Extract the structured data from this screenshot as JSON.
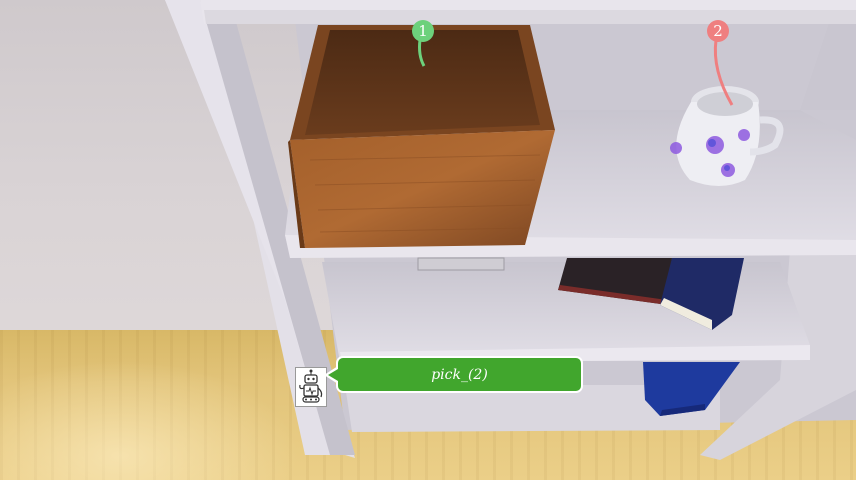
{
  "colors": {
    "marker_1": "#6dd17c",
    "marker_2": "#ef7f80",
    "bubble": "#41a62d"
  },
  "markers": [
    {
      "label": "1"
    },
    {
      "label": "2"
    }
  ],
  "action_bubble": {
    "text": "pick_(2)"
  },
  "icons": {
    "agent": "robot-icon"
  }
}
